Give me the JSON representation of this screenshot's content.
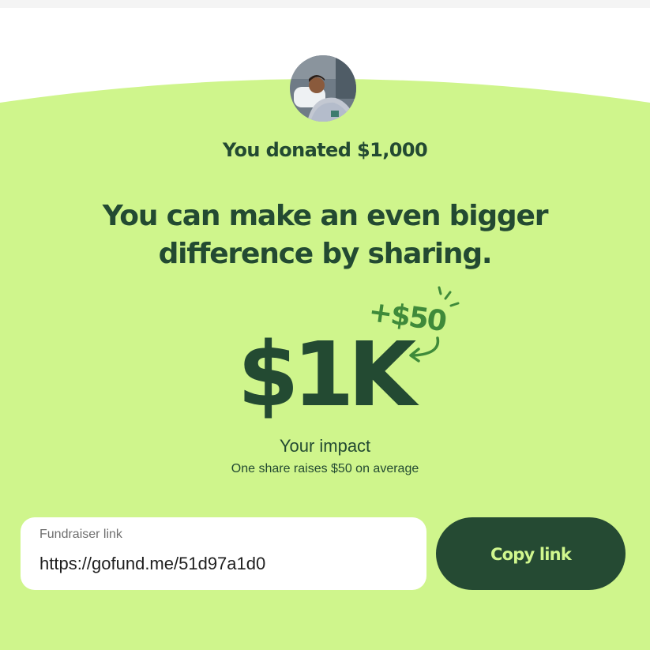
{
  "colors": {
    "background_green": "#cff58c",
    "dark_green": "#234a32",
    "accent_green": "#3f8a3a",
    "button_text": "#d0f78e"
  },
  "header": {
    "avatar_icon": "fundraiser-organizer-avatar"
  },
  "donation": {
    "donated_text": "You donated $1,000"
  },
  "headline": {
    "line1": "You can make an even bigger",
    "line2": "difference by sharing."
  },
  "impact": {
    "amount": "$1K",
    "bonus": "+$50",
    "label": "Your impact",
    "subtext": "One share raises $50 on average"
  },
  "share": {
    "field_label": "Fundraiser link",
    "link_value": "https://gofund.me/51d97a1d0",
    "copy_button_label": "Copy link"
  }
}
